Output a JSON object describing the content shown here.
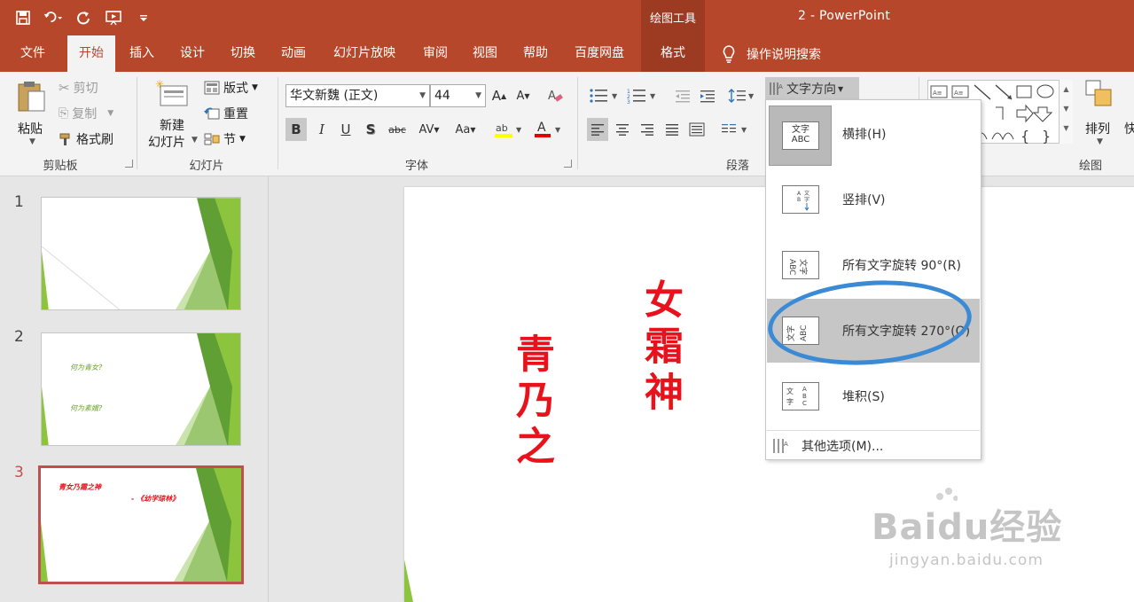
{
  "app": {
    "contextual_group": "绘图工具",
    "document_title": "2  -  PowerPoint"
  },
  "quick_access": [
    "save-icon",
    "undo-icon",
    "redo-icon",
    "present-icon",
    "customize-icon"
  ],
  "tabs": [
    {
      "label": "文件"
    },
    {
      "label": "开始"
    },
    {
      "label": "插入"
    },
    {
      "label": "设计"
    },
    {
      "label": "切换"
    },
    {
      "label": "动画"
    },
    {
      "label": "幻灯片放映"
    },
    {
      "label": "审阅"
    },
    {
      "label": "视图"
    },
    {
      "label": "帮助"
    },
    {
      "label": "百度网盘"
    },
    {
      "label": "格式"
    }
  ],
  "tell_me": "操作说明搜索",
  "ribbon": {
    "clipboard": {
      "label": "剪贴板",
      "paste": "粘贴",
      "cut": "剪切",
      "copy": "复制",
      "format_painter": "格式刷"
    },
    "slides": {
      "label": "幻灯片",
      "new_slide_line1": "新建",
      "new_slide_line2": "幻灯片",
      "layout": "版式",
      "reset": "重置",
      "section": "节"
    },
    "font": {
      "label": "字体",
      "font_name": "华文新魏 (正文)",
      "font_size": "44"
    },
    "paragraph": {
      "label": "段落",
      "text_direction": "文字方向"
    },
    "drawing": {
      "label": "绘图",
      "arrange": "排列",
      "quick_styles": "快"
    }
  },
  "slides_panel": [
    {
      "number": "1",
      "lines": []
    },
    {
      "number": "2",
      "lines": [
        "何为青女?",
        "何为素娥?"
      ]
    },
    {
      "number": "3",
      "lines": [
        "青女乃霜之神",
        "- 《幼学琼林》"
      ]
    }
  ],
  "slide_content": {
    "column1": "女霜神",
    "column2": "青乃之"
  },
  "text_direction_menu": {
    "items": [
      {
        "label": "横排(H)",
        "icon": "horizontal-text-icon"
      },
      {
        "label": "竖排(V)",
        "icon": "vertical-text-icon"
      },
      {
        "label": "所有文字旋转 90°(R)",
        "icon": "rotate-90-icon"
      },
      {
        "label": "所有文字旋转 270°(O)",
        "icon": "rotate-270-icon"
      },
      {
        "label": "堆积(S)",
        "icon": "stacked-text-icon"
      }
    ],
    "more_options": "其他选项(M)...",
    "highlighted_index": 3
  },
  "watermark": {
    "brand": "Baidu经验",
    "url": "jingyan.baidu.com"
  },
  "colors": {
    "title_bar": "#b7472a",
    "contextual": "#9c3b22",
    "slide_text": "#e8121c",
    "annotation": "#3a8ad6"
  }
}
